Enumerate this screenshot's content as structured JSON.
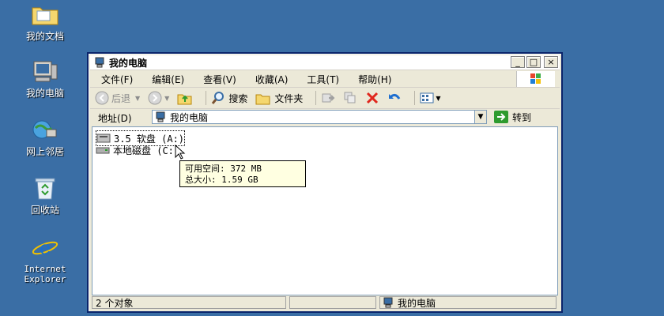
{
  "desktop": {
    "icons": [
      {
        "label": "我的文档"
      },
      {
        "label": "我的电脑"
      },
      {
        "label": "网上邻居"
      },
      {
        "label": "回收站"
      },
      {
        "label_line1": "Internet",
        "label_line2": "Explorer"
      }
    ]
  },
  "window": {
    "title": "我的电脑",
    "buttons": {
      "minimize": "_",
      "maximize": "□",
      "close": "×"
    },
    "menu": [
      "文件(F)",
      "编辑(E)",
      "查看(V)",
      "收藏(A)",
      "工具(T)",
      "帮助(H)"
    ],
    "toolbar": {
      "back": "后退",
      "search": "搜索",
      "folders": "文件夹"
    },
    "address": {
      "label": "地址(D)",
      "value": "我的电脑",
      "go": "转到"
    },
    "items": [
      {
        "label": "3.5 软盘 (A:)"
      },
      {
        "label": "本地磁盘 (C:)"
      }
    ],
    "tooltip": {
      "line1": "可用空间: 372 MB",
      "line2": "总大小: 1.59 GB"
    },
    "status": {
      "count": "2 个对象",
      "location": "我的电脑"
    }
  }
}
